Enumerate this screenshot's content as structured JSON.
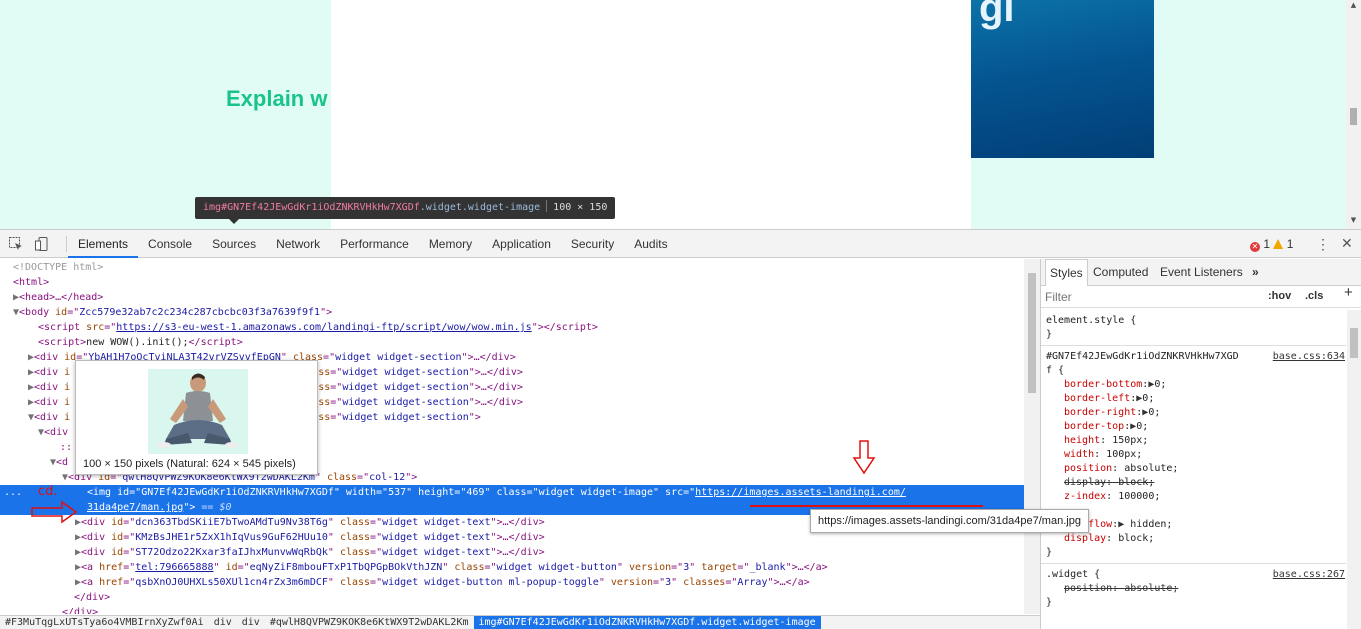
{
  "page": {
    "heading": "Explain w",
    "hero_logo": "gi"
  },
  "inspect_tooltip": {
    "tag": "img",
    "selector": "#GN7Ef42JEwGdKr1iOdZNKRVHkHw7XGDf",
    "classes": ".widget.widget-image",
    "size": "100 × 150"
  },
  "toolbar": {
    "tabs": [
      "Elements",
      "Console",
      "Sources",
      "Network",
      "Performance",
      "Memory",
      "Application",
      "Security",
      "Audits"
    ],
    "active_tab": "Elements",
    "error_count": "1",
    "warning_count": "1"
  },
  "dom": {
    "doctype": "<!DOCTYPE html>",
    "html_open": "<html>",
    "head": "<head>…</head>",
    "body_id": "Zcc579e32ab7c2c234c287cbcbc03f3a7639f9f1",
    "script1_src": "https://s3-eu-west-1.amazonaws.com/landingi-ftp/script/wow/wow.min.js",
    "script2_text": "new WOW().init();",
    "section_ids": [
      "YbAH1H7oOcTviNLA3T42vrVZSvvfEpGN"
    ],
    "section_class": "widget widget-section",
    "col_id": "qwlH8QVPWZ9KOK8e6KtWX9T2wDAKL2Km",
    "col_class": "col-12",
    "img_id": "GN7Ef42JEwGdKr1iOdZNKRVHkHw7XGDf",
    "img_width": "537",
    "img_height": "469",
    "img_class": "widget widget-image",
    "img_src_part1": "https://images.assets-landingi.com/",
    "img_src_part2": "31da4pe7/man.jpg",
    "selected_marker": "== $0",
    "text_div_ids": [
      "dcn363TbdSKiiE7bTwoAMdTu9Nv38T6g",
      "KMzBsJHE1r5ZxX1hIqVus9GuF62HUu10",
      "ST72Odzo22Kxar3faIJhxMunvwWqRbQk"
    ],
    "text_div_class": "widget widget-text",
    "a1_href": "tel:796665888",
    "a1_id": "eqNyZiF8mbouFTxP1TbQPGpBOkVthJZN",
    "a1_class": "widget widget-button",
    "a1_version": "3",
    "a1_target": "_blank",
    "a2_href": "qsbXnOJ0UHXLs50XUl1cn4rZx3m6mDCF",
    "a2_class": "widget widget-button ml-popup-toggle",
    "a2_version": "3",
    "a2_classes": "Array"
  },
  "image_preview": {
    "caption": "100 × 150 pixels (Natural: 624 × 545 pixels)"
  },
  "url_tooltip": "https://images.assets-landingi.com/31da4pe7/man.jpg",
  "annotation": "cd.",
  "breadcrumbs": [
    "#F3MuTqgLxUTsTya6o4VMBIrnXyZwf0Ai",
    "div",
    "div",
    "#qwlH8QVPWZ9KOK8e6KtWX9T2wDAKL2Km",
    "img#GN7Ef42JEwGdKr1iOdZNKRVHkHw7XGDf.widget.widget-image"
  ],
  "styles_pane": {
    "tabs": [
      "Styles",
      "Computed",
      "Event Listeners"
    ],
    "filter_placeholder": "Filter",
    "hov": ":hov",
    "cls": ".cls",
    "element_style": "element.style {",
    "rule1_selector": "#GN7Ef42JEwGdKr1iOdZNKRVHkHw7XGD",
    "rule1_selector_cont": "f {",
    "rule1_source": "base.css:634",
    "rule1_props": [
      {
        "name": "border-bottom",
        "value": "0;",
        "expand": true,
        "struck": false
      },
      {
        "name": "border-left",
        "value": "0;",
        "expand": true,
        "struck": false
      },
      {
        "name": "border-right",
        "value": "0;",
        "expand": true,
        "struck": false
      },
      {
        "name": "border-top",
        "value": "0;",
        "expand": true,
        "struck": false
      },
      {
        "name": "height",
        "value": "150px;",
        "expand": false,
        "struck": false
      },
      {
        "name": "width",
        "value": "100px;",
        "expand": false,
        "struck": false
      },
      {
        "name": "position",
        "value": "absolute;",
        "expand": false,
        "struck": false
      },
      {
        "name": "display",
        "value": "block;",
        "expand": false,
        "struck": true
      },
      {
        "name": "z-index",
        "value": "100000;",
        "expand": false,
        "struck": false
      }
    ],
    "rule1_more": [
      {
        "name": "overflow",
        "value": "hidden;",
        "expand": true
      },
      {
        "name": "display",
        "value": "block;",
        "expand": false
      }
    ],
    "rule2_selector": ".widget {",
    "rule2_source": "base.css:267",
    "rule2_prop": {
      "name": "position",
      "value": "absolute;"
    }
  }
}
